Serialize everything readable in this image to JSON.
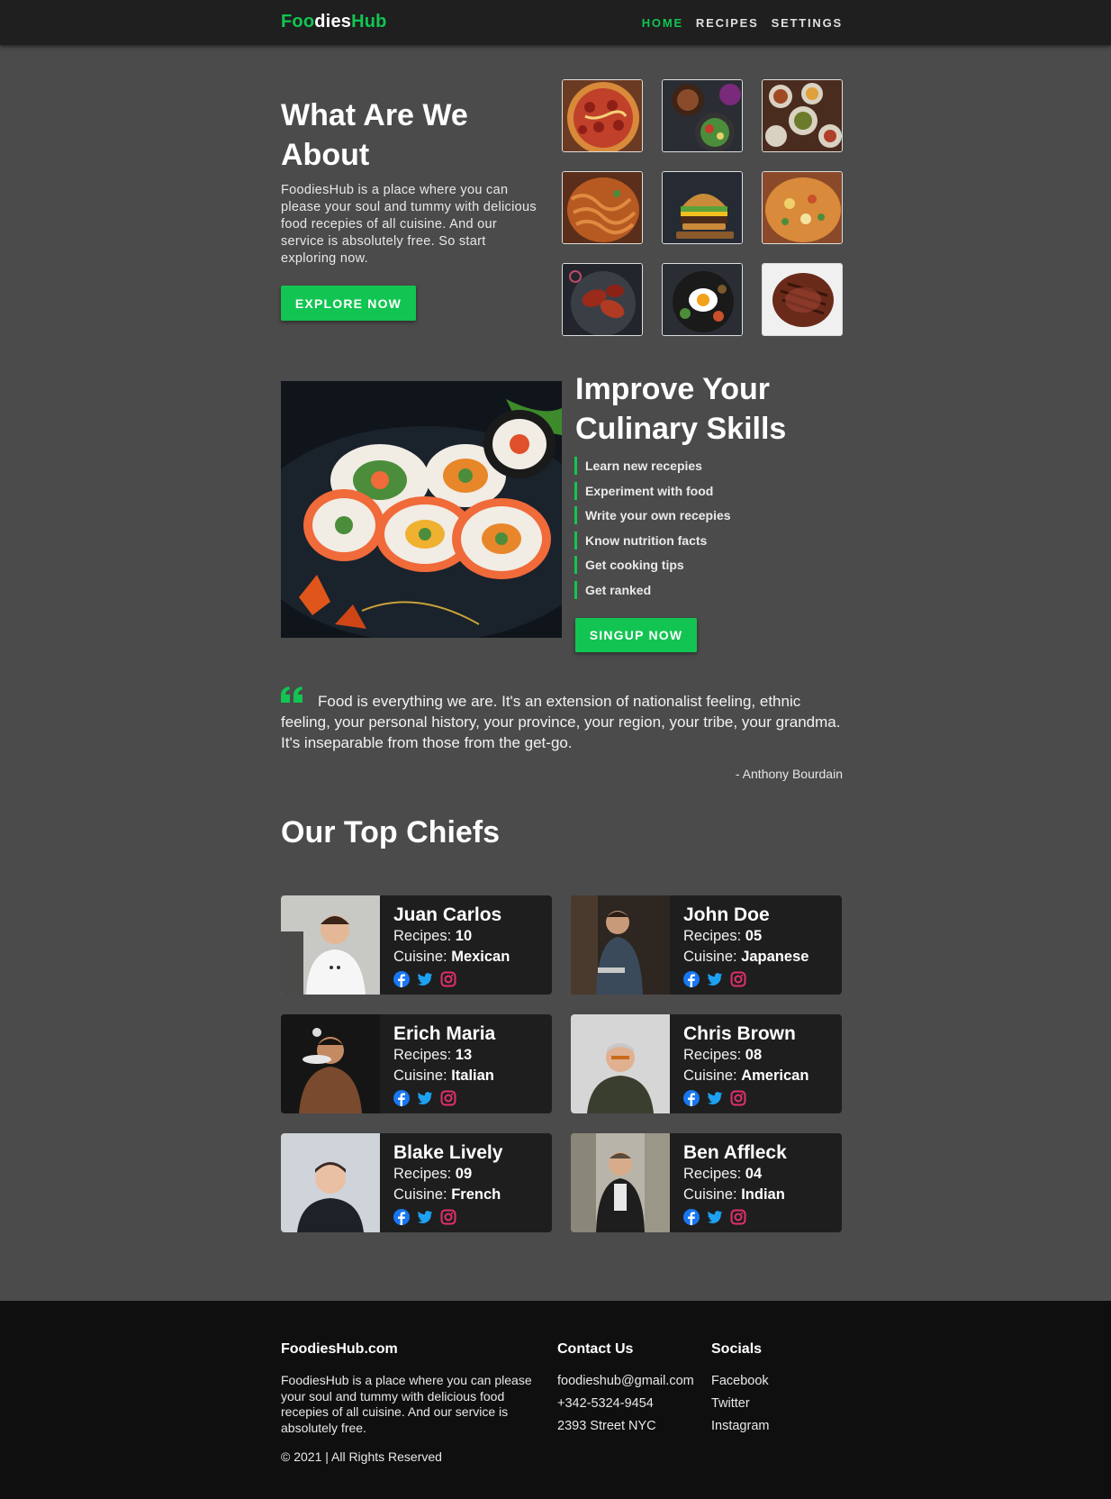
{
  "nav": {
    "logo_green": "Foo",
    "logo_white": "dies",
    "logo_green2": "Hub",
    "links": [
      "HOME",
      "RECIPES",
      "SETTINGS"
    ]
  },
  "about": {
    "title": "What Are We About",
    "text": "FoodiesHub is a place where you can please your soul and tummy with delicious food recepies of all cuisine. And our service is absolutely free. So start exploring now.",
    "button": "EXPLORE NOW",
    "gallery": [
      "pizza-image",
      "salad-bowls-image",
      "table-dishes-image",
      "noodles-image",
      "burger-image",
      "biryani-image",
      "chicken-wings-image",
      "fried-egg-rice-image",
      "steak-image"
    ]
  },
  "culinary": {
    "title": "Improve Your Culinary Skills",
    "skills": [
      "Learn new recepies",
      "Experiment with food",
      "Write your own recepies",
      "Know nutrition facts",
      "Get cooking tips",
      "Get ranked"
    ],
    "button": "SINGUP NOW"
  },
  "quote": {
    "text": "Food is everything we are. It's an extension of nationalist feeling, ethnic feeling, your personal history, your province, your region, your tribe, your grandma. It's inseparable from those from the get-go.",
    "author": "- Anthony Bourdain"
  },
  "chefs": {
    "title": "Our Top Chiefs",
    "recipes_label": "Recipes: ",
    "cuisine_label": "Cuisine: ",
    "list": [
      {
        "name": "Juan Carlos",
        "recipes": "10",
        "cuisine": "Mexican"
      },
      {
        "name": "John Doe",
        "recipes": "05",
        "cuisine": "Japanese"
      },
      {
        "name": "Erich Maria",
        "recipes": "13",
        "cuisine": "Italian"
      },
      {
        "name": "Chris Brown",
        "recipes": "08",
        "cuisine": "American"
      },
      {
        "name": "Blake Lively",
        "recipes": "09",
        "cuisine": "French"
      },
      {
        "name": "Ben Affleck",
        "recipes": "04",
        "cuisine": "Indian"
      }
    ]
  },
  "footer": {
    "brand": "FoodiesHub.com",
    "text": "FoodiesHub is a place where you can please your soul and tummy with delicious food recepies of all cuisine. And our service is absolutely free.",
    "copyright": "© 2021 | All Rights Reserved",
    "contact_title": "Contact Us",
    "contact": [
      "foodieshub@gmail.com",
      "+342-5324-9454",
      "2393 Street NYC"
    ],
    "socials_title": "Socials",
    "socials": [
      "Facebook",
      "Twitter",
      "Instagram"
    ]
  },
  "colors": {
    "accent": "#12c552",
    "background": "#4b4b4b",
    "nav": "#1f1f1f",
    "card": "#1e1e1e",
    "footer": "#0f0f0f",
    "facebook": "#1877f2",
    "twitter": "#1da1f2",
    "instagram": "#e1306c"
  }
}
